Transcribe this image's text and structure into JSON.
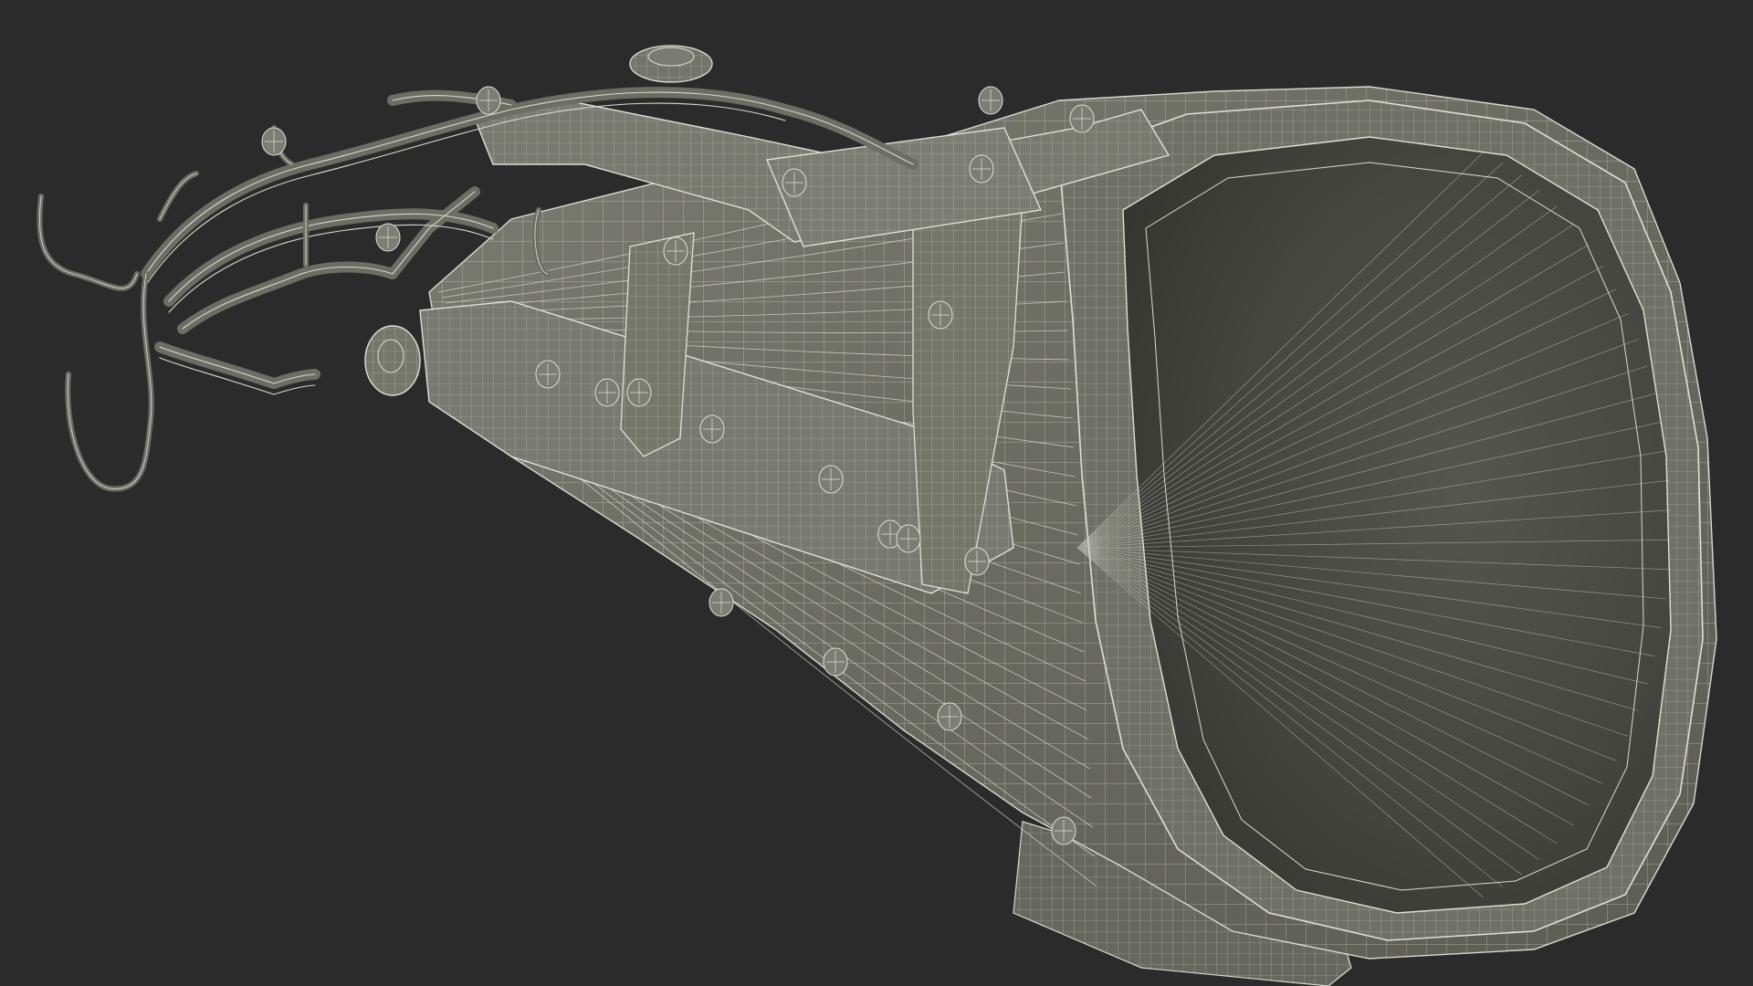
{
  "scene": {
    "subject": "",
    "colors": {
      "background": "#2b2b2b",
      "shell": "#6d6e63",
      "shell_light": "#7a7b70",
      "inner": "#4a4b43",
      "inner_dark": "#3c3d36",
      "strap": "#76776b",
      "wire": "#d9d9cf",
      "wire_dim": "#bfc0b4"
    }
  }
}
